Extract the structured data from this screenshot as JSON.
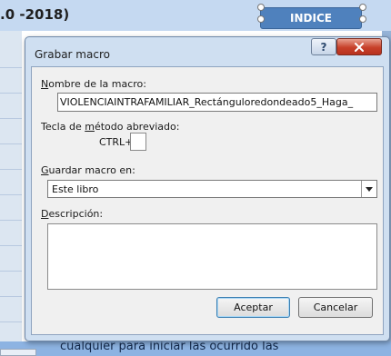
{
  "background": {
    "sheet_title": ".0 -2018)",
    "shape_label": "INDICE",
    "bottom_text": "cualquier para iniciar las ocurrido las"
  },
  "dialog": {
    "title": "Grabar macro",
    "help_button": "?",
    "close_button": "x",
    "macro_name_label": "Nombre de la macro:",
    "macro_name_value": "VIOLENCIAINTRAFAMILIAR_Rectánguloredondeado5_Haga_",
    "shortcut_label": "Tecla de método abreviado:",
    "shortcut_prefix": "CTRL+",
    "shortcut_value": "",
    "store_in_label": "Guardar macro en:",
    "store_in_value": "Este libro",
    "description_label": "Descripción:",
    "description_value": "",
    "ok_button": "Aceptar",
    "cancel_button": "Cancelar"
  },
  "colors": {
    "dialog_frame": "#cfdff1",
    "shape_fill": "#4f81bd",
    "close_button": "#c7402a"
  }
}
